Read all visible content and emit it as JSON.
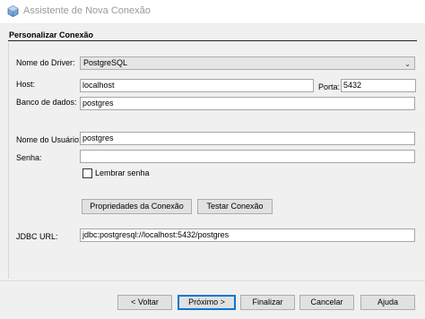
{
  "window": {
    "title": "Assistente de Nova Conexão",
    "icon": "netbeans-cube-icon"
  },
  "section": {
    "title": "Personalizar Conexão"
  },
  "form": {
    "driver_label": "Nome do Driver:",
    "driver_value": "PostgreSQL",
    "host_label": "Host:",
    "host_value": "localhost",
    "port_label": "Porta:",
    "port_value": "5432",
    "database_label": "Banco de dados:",
    "database_value": "postgres",
    "username_label": "Nome do Usuário:",
    "username_value": "postgres",
    "password_label": "Senha:",
    "password_value": "",
    "remember_label": "Lembrar senha",
    "remember_checked": false,
    "properties_button": "Propriedades da Conexão",
    "test_button": "Testar Conexão",
    "jdbc_label": "JDBC URL:",
    "jdbc_value": "jdbc:postgresql://localhost:5432/postgres"
  },
  "footer": {
    "back": "< Voltar",
    "next": "Próximo >",
    "finish": "Finalizar",
    "cancel": "Cancelar",
    "help": "Ajuda"
  }
}
